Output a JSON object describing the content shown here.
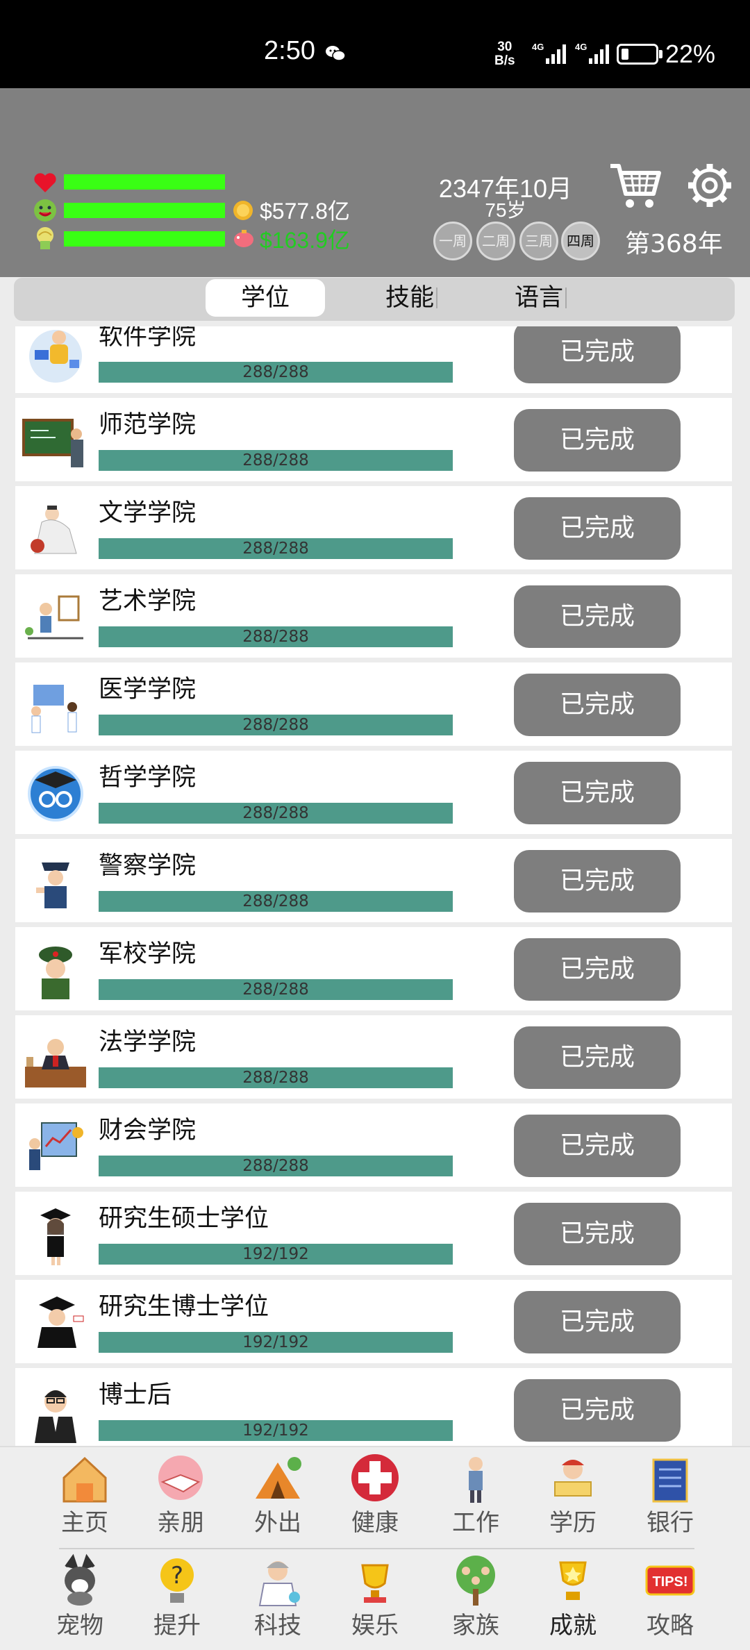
{
  "status_bar": {
    "time": "2:50",
    "speed_top": "30",
    "speed_bottom": "B/s",
    "battery": "22%"
  },
  "header": {
    "money": "$577.8亿",
    "money2": "$163.9亿",
    "date": "2347年10月",
    "age": "75岁",
    "weeks": [
      "一周",
      "二周",
      "三周",
      "四周"
    ],
    "year": "第368年",
    "colors": {
      "bar": "#39ff14",
      "money2": "#22cc22"
    }
  },
  "tabs": [
    "学位",
    "技能",
    "语言"
  ],
  "rows": [
    {
      "name": "软件学院",
      "progress": "288/288",
      "button": "已完成",
      "icon": "software-student-icon"
    },
    {
      "name": "师范学院",
      "progress": "288/288",
      "button": "已完成",
      "icon": "teacher-blackboard-icon"
    },
    {
      "name": "文学学院",
      "progress": "288/288",
      "button": "已完成",
      "icon": "poet-icon"
    },
    {
      "name": "艺术学院",
      "progress": "288/288",
      "button": "已完成",
      "icon": "painter-icon"
    },
    {
      "name": "医学学院",
      "progress": "288/288",
      "button": "已完成",
      "icon": "doctors-icon"
    },
    {
      "name": "哲学学院",
      "progress": "288/288",
      "button": "已完成",
      "icon": "philosophy-cap-icon"
    },
    {
      "name": "警察学院",
      "progress": "288/288",
      "button": "已完成",
      "icon": "police-icon"
    },
    {
      "name": "军校学院",
      "progress": "288/288",
      "button": "已完成",
      "icon": "soldier-icon"
    },
    {
      "name": "法学学院",
      "progress": "288/288",
      "button": "已完成",
      "icon": "judge-icon"
    },
    {
      "name": "财会学院",
      "progress": "288/288",
      "button": "已完成",
      "icon": "accountant-icon"
    },
    {
      "name": "研究生硕士学位",
      "progress": "192/192",
      "button": "已完成",
      "icon": "graduate-girl-icon"
    },
    {
      "name": "研究生博士学位",
      "progress": "192/192",
      "button": "已完成",
      "icon": "graduate-boy-icon"
    },
    {
      "name": "博士后",
      "progress": "192/192",
      "button": "已完成",
      "icon": "postdoc-icon"
    }
  ],
  "nav_top": [
    "主页",
    "亲朋",
    "外出",
    "健康",
    "工作",
    "学历",
    "银行"
  ],
  "nav_bottom": [
    "宠物",
    "提升",
    "科技",
    "娱乐",
    "家族",
    "成就",
    "攻略"
  ]
}
